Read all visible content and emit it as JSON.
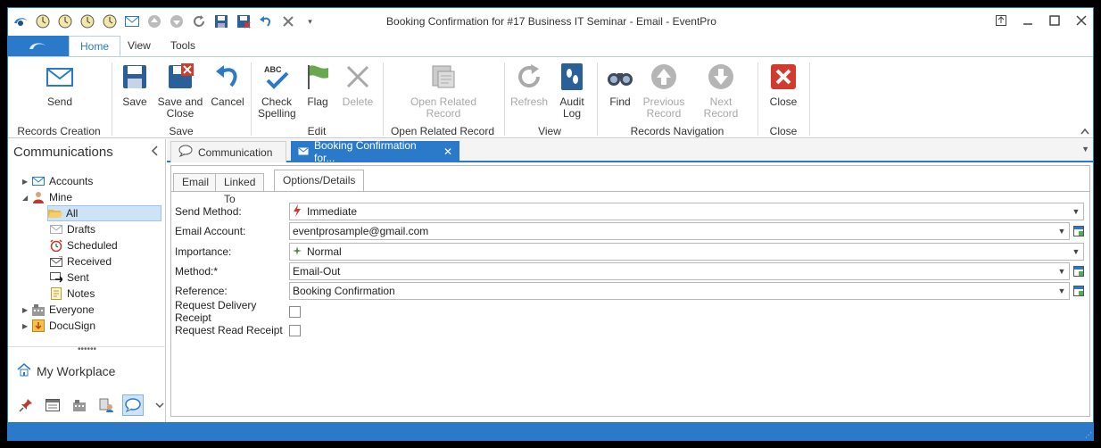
{
  "window": {
    "title": "Booking Confirmation for #17 Business IT Seminar - Email - EventPro"
  },
  "quick_access": [
    "app-logo-icon",
    "clock-icon",
    "clock-icon",
    "clock-icon",
    "clock-icon",
    "mail-icon",
    "up-arrow-icon",
    "down-arrow-icon",
    "refresh-icon",
    "save-icon",
    "save-close-icon",
    "undo-icon",
    "close-x-icon",
    "customize-dropdown-icon"
  ],
  "ribbon_tabs": [
    "Home",
    "View",
    "Tools"
  ],
  "ribbon": {
    "send": "Send",
    "save": "Save",
    "save_and_close_1": "Save and",
    "save_and_close_2": "Close",
    "cancel": "Cancel",
    "check_spelling_1": "Check",
    "check_spelling_2": "Spelling",
    "flag": "Flag",
    "delete": "Delete",
    "open_related_1": "Open Related",
    "open_related_2": "Record",
    "refresh": "Refresh",
    "audit_log_1": "Audit",
    "audit_log_2": "Log",
    "find": "Find",
    "previous_record_1": "Previous",
    "previous_record_2": "Record",
    "next_record": "Next Record",
    "close": "Close",
    "groups": {
      "records_creation": "Records Creation",
      "save": "Save",
      "edit": "Edit",
      "open_related_record": "Open Related Record",
      "view": "View",
      "records_navigation": "Records Navigation",
      "close": "Close"
    }
  },
  "nav": {
    "title": "Communications",
    "items": [
      {
        "label": "Accounts"
      },
      {
        "label": "Mine"
      },
      {
        "label": "All"
      },
      {
        "label": "Drafts"
      },
      {
        "label": "Scheduled"
      },
      {
        "label": "Received"
      },
      {
        "label": "Sent"
      },
      {
        "label": "Notes"
      },
      {
        "label": "Everyone"
      },
      {
        "label": "DocuSign"
      }
    ],
    "grip": "••••••",
    "workplace": "My Workplace"
  },
  "doc_tabs": {
    "communication": "Communication",
    "booking": "Booking Confirmation for..."
  },
  "sub_tabs": [
    "Email",
    "Linked To",
    "Options/Details"
  ],
  "form": {
    "send_method_label": "Send Method:",
    "send_method_value": "Immediate",
    "email_account_label": "Email Account:",
    "email_account_value": "eventprosample@gmail.com",
    "importance_label": "Importance:",
    "importance_value": "Normal",
    "method_label": "Method:*",
    "method_value": "Email-Out",
    "reference_label": "Reference:",
    "reference_value": "Booking Confirmation",
    "delivery_receipt_label": "Request Delivery Receipt",
    "delivery_receipt_checked": false,
    "read_receipt_label": "Request Read Receipt",
    "read_receipt_checked": false
  },
  "colors": {
    "accent": "#2b79c9",
    "selection": "#cfe3f7"
  }
}
